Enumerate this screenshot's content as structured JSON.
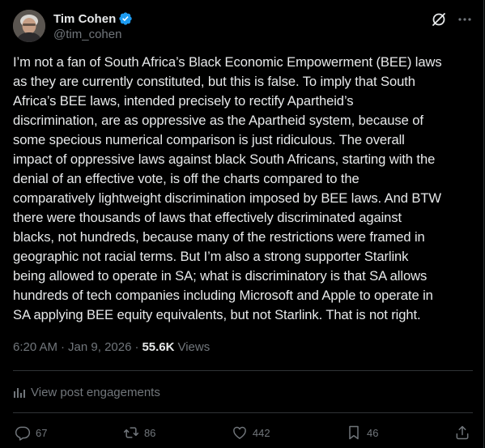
{
  "author": {
    "display_name": "Tim Cohen",
    "handle": "@tim_cohen",
    "verified": true
  },
  "tweet": {
    "text": "I’m not a fan of South Africa’s Black Economic Empowerment (BEE) laws\nas they are currently constituted, but this is false. To imply that South\nAfrica’s BEE laws, intended precisely to rectify Apartheid’s\ndiscrimination, are as oppressive as the Apartheid system, because of\nsome specious numerical comparison is just ridiculous. The overall\nimpact of oppressive laws against black South Africans, starting with the\ndenial of an effective vote, is off the charts compared to the\ncomparatively lightweight discrimination imposed by BEE laws. And BTW\nthere were thousands of laws that effectively discriminated against\nblacks, not hundreds, because many of the restrictions were framed in\ngeographic not racial terms. But I’m also a strong supporter Starlink\nbeing allowed to operate in SA; what is discriminatory is that SA allows\nhundreds of tech companies including Microsoft and Apple to operate in\nSA applying BEE equity equivalents, but not Starlink. That is not right.",
    "time": "6:20 AM",
    "date": "Jan 9, 2026",
    "separator": "·",
    "views_count": "55.6K",
    "views_label": "Views"
  },
  "engagements_label": "View post engagements",
  "actions": {
    "replies": "67",
    "reposts": "86",
    "likes": "442",
    "bookmarks": "46"
  },
  "colors": {
    "background": "#000000",
    "text_primary": "#e7e9ea",
    "text_secondary": "#71767b",
    "divider": "#2f3336",
    "verified_badge": "#1d9bf0"
  },
  "icons": [
    "verified-badge-icon",
    "grok-icon",
    "more-icon",
    "analytics-icon",
    "reply-icon",
    "repost-icon",
    "like-icon",
    "bookmark-icon",
    "share-icon"
  ]
}
